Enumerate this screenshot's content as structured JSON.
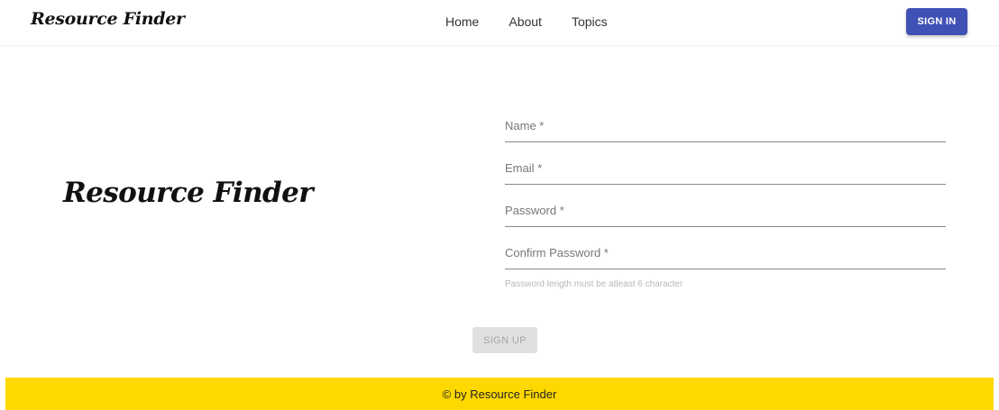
{
  "header": {
    "brand": "Resource Finder",
    "nav": {
      "home": "Home",
      "about": "About",
      "topics": "Topics"
    },
    "signin_label": "SIGN IN"
  },
  "hero": {
    "title": "Resource Finder"
  },
  "form": {
    "name_label": "Name *",
    "email_label": "Email *",
    "password_label": "Password *",
    "confirm_label": "Confirm Password *",
    "helper": "Password length must be atleast 6 character",
    "signup_label": "SIGN UP"
  },
  "footer": {
    "text": "© by Resource Finder"
  },
  "colors": {
    "primary": "#3f51b5",
    "footer_bg": "#ffd800",
    "disabled_bg": "#e0e0e0"
  }
}
